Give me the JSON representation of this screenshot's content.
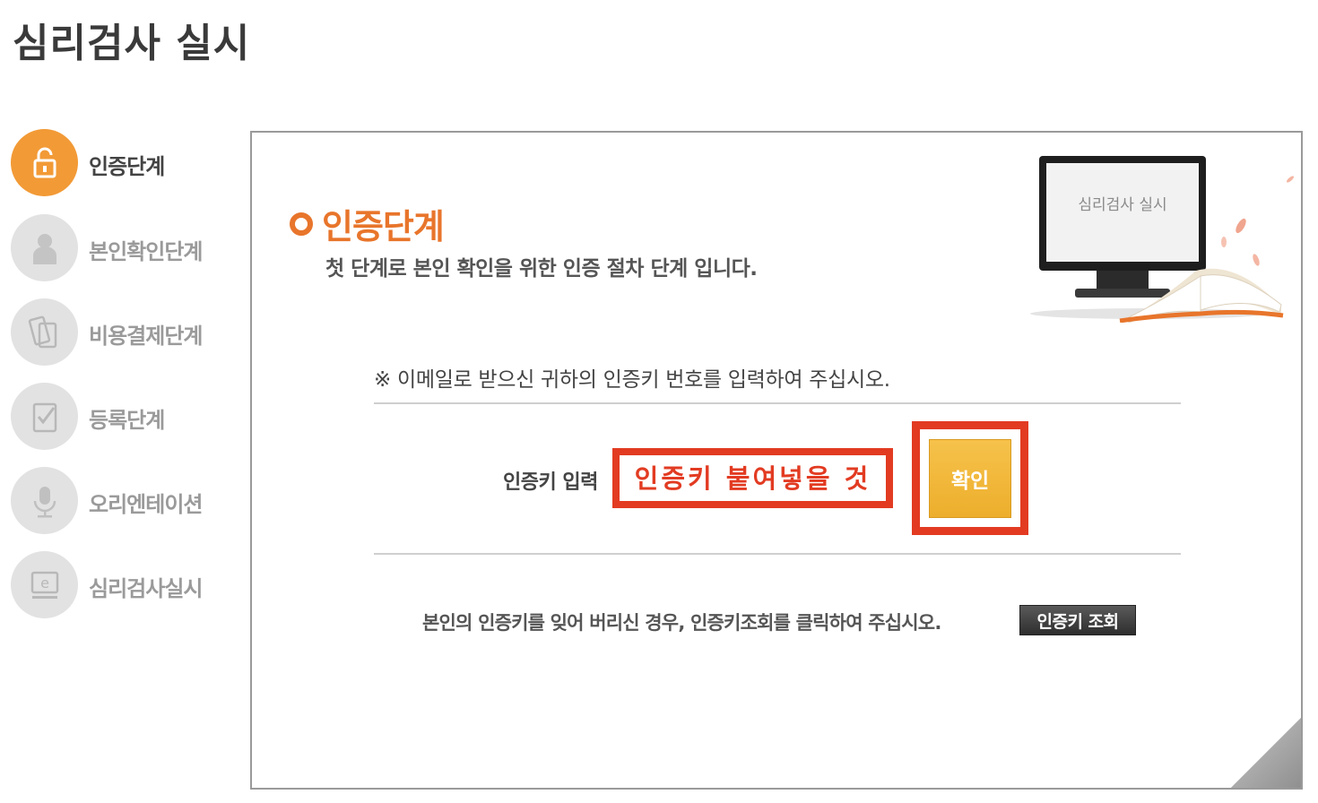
{
  "page": {
    "title": "심리검사 실시"
  },
  "sidebar": {
    "items": [
      {
        "label": "인증단계",
        "icon": "lock-icon",
        "active": true
      },
      {
        "label": "본인확인단계",
        "icon": "person-icon",
        "active": false
      },
      {
        "label": "비용결제단계",
        "icon": "payment-card-icon",
        "active": false
      },
      {
        "label": "등록단계",
        "icon": "checklist-icon",
        "active": false
      },
      {
        "label": "오리엔테이션",
        "icon": "microphone-icon",
        "active": false
      },
      {
        "label": "심리검사실시",
        "icon": "e-test-monitor-icon",
        "active": false
      }
    ]
  },
  "main": {
    "section_title": "인증단계",
    "section_desc": "첫 단계로 본인 확인을 위한 인증 절차 단계 입니다.",
    "illustration": {
      "screen_text": "심리검사 실시"
    },
    "instruction": "※ 이메일로 받으신 귀하의 인증키 번호를 입력하여 주십시오.",
    "key_label": "인증키 입력",
    "key_input": {
      "value": "",
      "placeholder": "인증키 붙여넣을 것"
    },
    "confirm_label": "확인",
    "help_text": "본인의 인증키를 잊어 버리신 경우, 인증키조회를 클릭하여 주십시오.",
    "lookup_label": "인증키 조회"
  },
  "colors": {
    "accent_orange": "#e8752b",
    "step_active": "#f29a36",
    "highlight_red": "#e23b22",
    "button_yellow": "#f0b535"
  }
}
